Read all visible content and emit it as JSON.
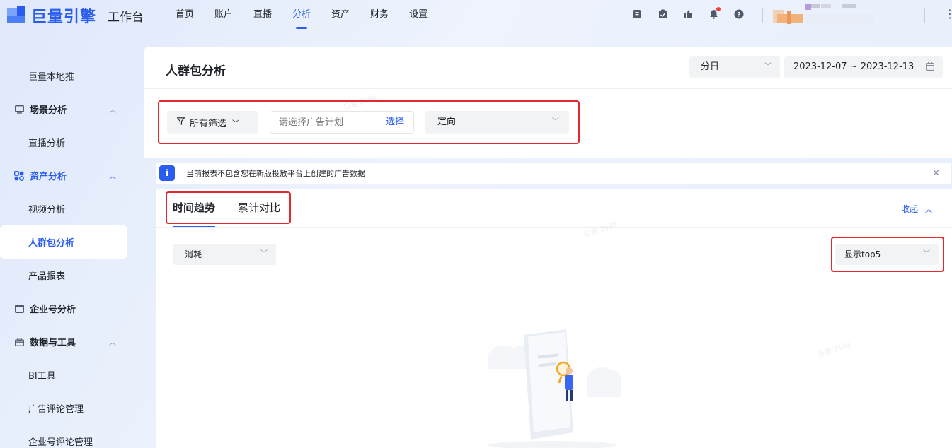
{
  "brand": {
    "name": "巨量引擎",
    "workspace": "工作台"
  },
  "nav": [
    "首页",
    "账户",
    "直播",
    "分析",
    "资产",
    "财务",
    "设置"
  ],
  "nav_active_index": 3,
  "sidebar": {
    "items": [
      {
        "type": "item",
        "label": "巨量本地推"
      },
      {
        "type": "group",
        "label": "场景分析"
      },
      {
        "type": "item",
        "label": "直播分析"
      },
      {
        "type": "group",
        "label": "资产分析"
      },
      {
        "type": "item",
        "label": "视频分析"
      },
      {
        "type": "item",
        "label": "人群包分析"
      },
      {
        "type": "item",
        "label": "产品报表"
      },
      {
        "type": "group",
        "label": "企业号分析"
      },
      {
        "type": "group",
        "label": "数据与工具"
      },
      {
        "type": "item",
        "label": "BI工具"
      },
      {
        "type": "item",
        "label": "广告评论管理"
      },
      {
        "type": "item",
        "label": "企业号评论管理"
      }
    ]
  },
  "page": {
    "title": "人群包分析",
    "granularity": "分日",
    "date_range": "2023-12-07 ~ 2023-12-13"
  },
  "filters": {
    "all_filters": "所有筛选",
    "plan_placeholder": "请选择广告计划",
    "plan_select": "选择",
    "targeting": "定向"
  },
  "notice": {
    "text": "当前报表不包含您在新版投放平台上创建的广告数据"
  },
  "tabs": [
    "时间趋势",
    "累计对比"
  ],
  "collapse_label": "收起",
  "metric_select": "消耗",
  "top_select": "显示top5",
  "colors": {
    "accent": "#2a5cf0",
    "highlight": "#e5282f"
  }
}
